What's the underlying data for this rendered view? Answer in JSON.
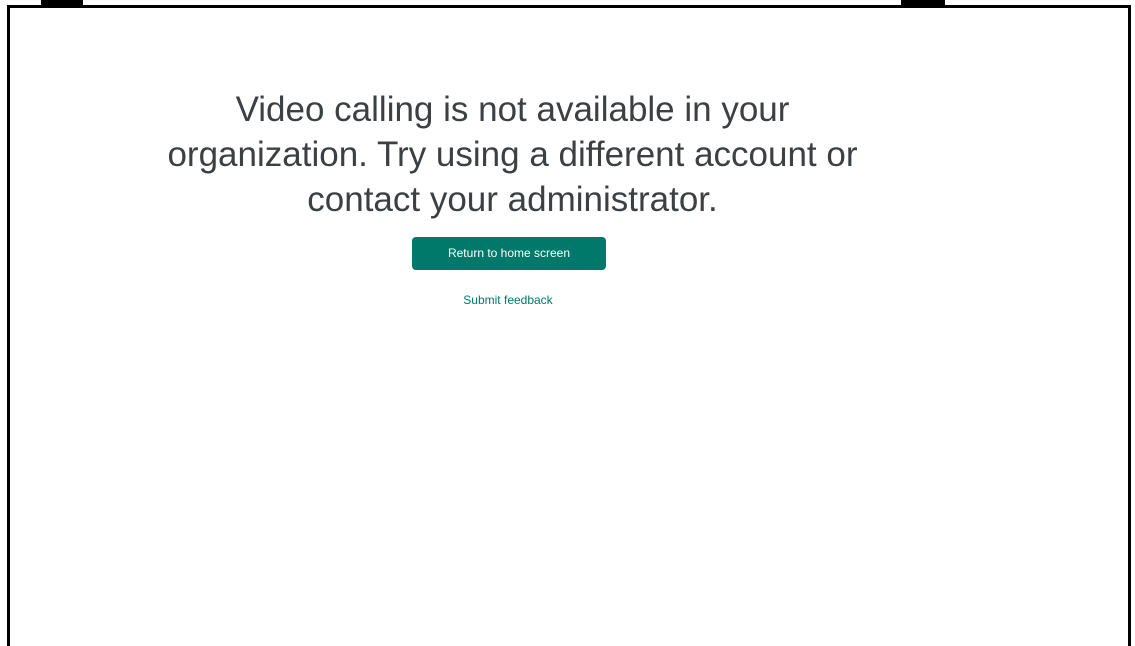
{
  "error_page": {
    "message": "Video calling is not available in your organization. Try using a different account or contact your administrator.",
    "primary_button_label": "Return to home screen",
    "feedback_link_label": "Submit feedback"
  },
  "colors": {
    "accent": "#00796b",
    "message_text": "#3c4043",
    "background": "#ffffff",
    "frame": "#000000"
  }
}
